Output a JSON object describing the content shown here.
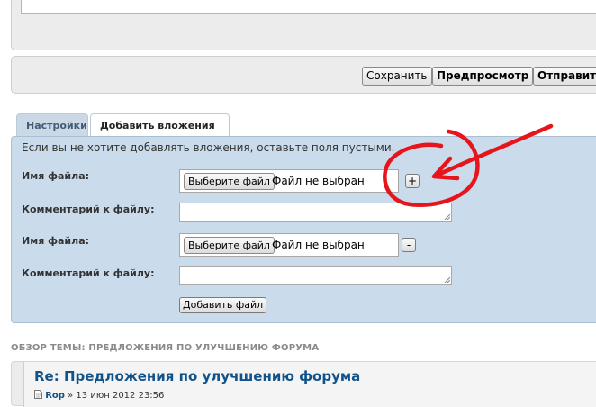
{
  "toolbar": {
    "save_label": "Сохранить",
    "preview_label": "Предпросмотр",
    "submit_label": "Отправить"
  },
  "tabs": [
    {
      "label": "Настройки",
      "active": false
    },
    {
      "label": "Добавить вложения",
      "active": true
    }
  ],
  "attachments": {
    "hint": "Если вы не хотите добавлять вложения, оставьте поля пустыми.",
    "rows": [
      {
        "file_label": "Имя файла:",
        "choose_button": "Выберите файл",
        "file_status": "Файл не выбран",
        "action_symbol": "+",
        "comment_label": "Комментарий к файлу:",
        "comment_value": ""
      },
      {
        "file_label": "Имя файла:",
        "choose_button": "Выберите файл",
        "file_status": "Файл не выбран",
        "action_symbol": "-",
        "comment_label": "Комментарий к файлу:",
        "comment_value": ""
      }
    ],
    "add_file_button": "Добавить файл"
  },
  "topic_overview": {
    "heading": "ОБЗОР ТЕМЫ: ПРЕДЛОЖЕНИЯ ПО УЛУЧШЕНИЮ ФОРУМА",
    "post": {
      "title": "Re: Предложения по улучшению форума",
      "author": "Rop",
      "separator": "»",
      "date": "13 июн 2012 23:56"
    }
  },
  "colors": {
    "panel_bg": "#ececec",
    "attach_bg": "#cadceb",
    "annotation": "#e8141c",
    "link": "#105289"
  }
}
